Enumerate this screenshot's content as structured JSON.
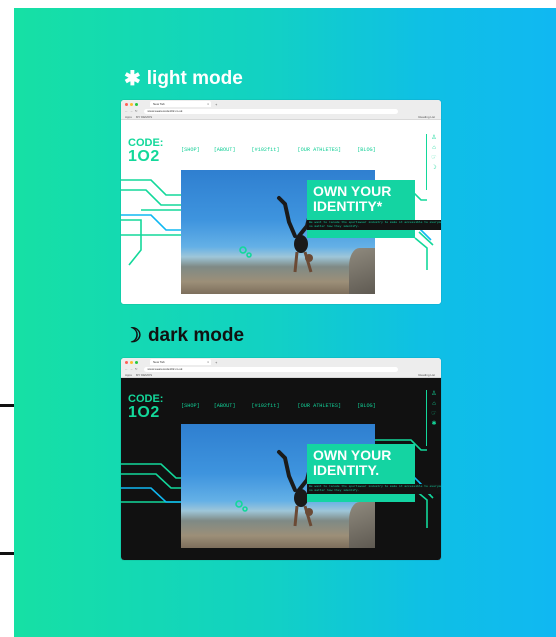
{
  "headings": {
    "light": {
      "icon": "✱",
      "text": "light mode"
    },
    "dark": {
      "icon": "☽",
      "text": "dark mode"
    }
  },
  "browser": {
    "tab_title": "New Tab",
    "url": "www.wearecode102.co.uk",
    "bookmarks": [
      "Apps",
      "MY DEMOS"
    ],
    "reading_list": "Reading List"
  },
  "site": {
    "logo_line1": "CODE:",
    "logo_line2": "1O2",
    "nav": [
      "[SHOP]",
      "[ABOUT]",
      "[#102fit]",
      "[OUR ATHLETES]",
      "[BLOG]"
    ],
    "headline_light_1": "OWN YOUR",
    "headline_light_2": "IDENTITY*",
    "headline_dark_1": "OWN YOUR",
    "headline_dark_2": "IDENTITY.",
    "subtext": "We want to recode the sportswear industry to make it accessible to everyone no matter how they identify."
  },
  "colors": {
    "brand_green": "#13d89a",
    "gradient_start": "#16e0a4",
    "gradient_end": "#10b8f2",
    "dark_bg": "#111111"
  }
}
